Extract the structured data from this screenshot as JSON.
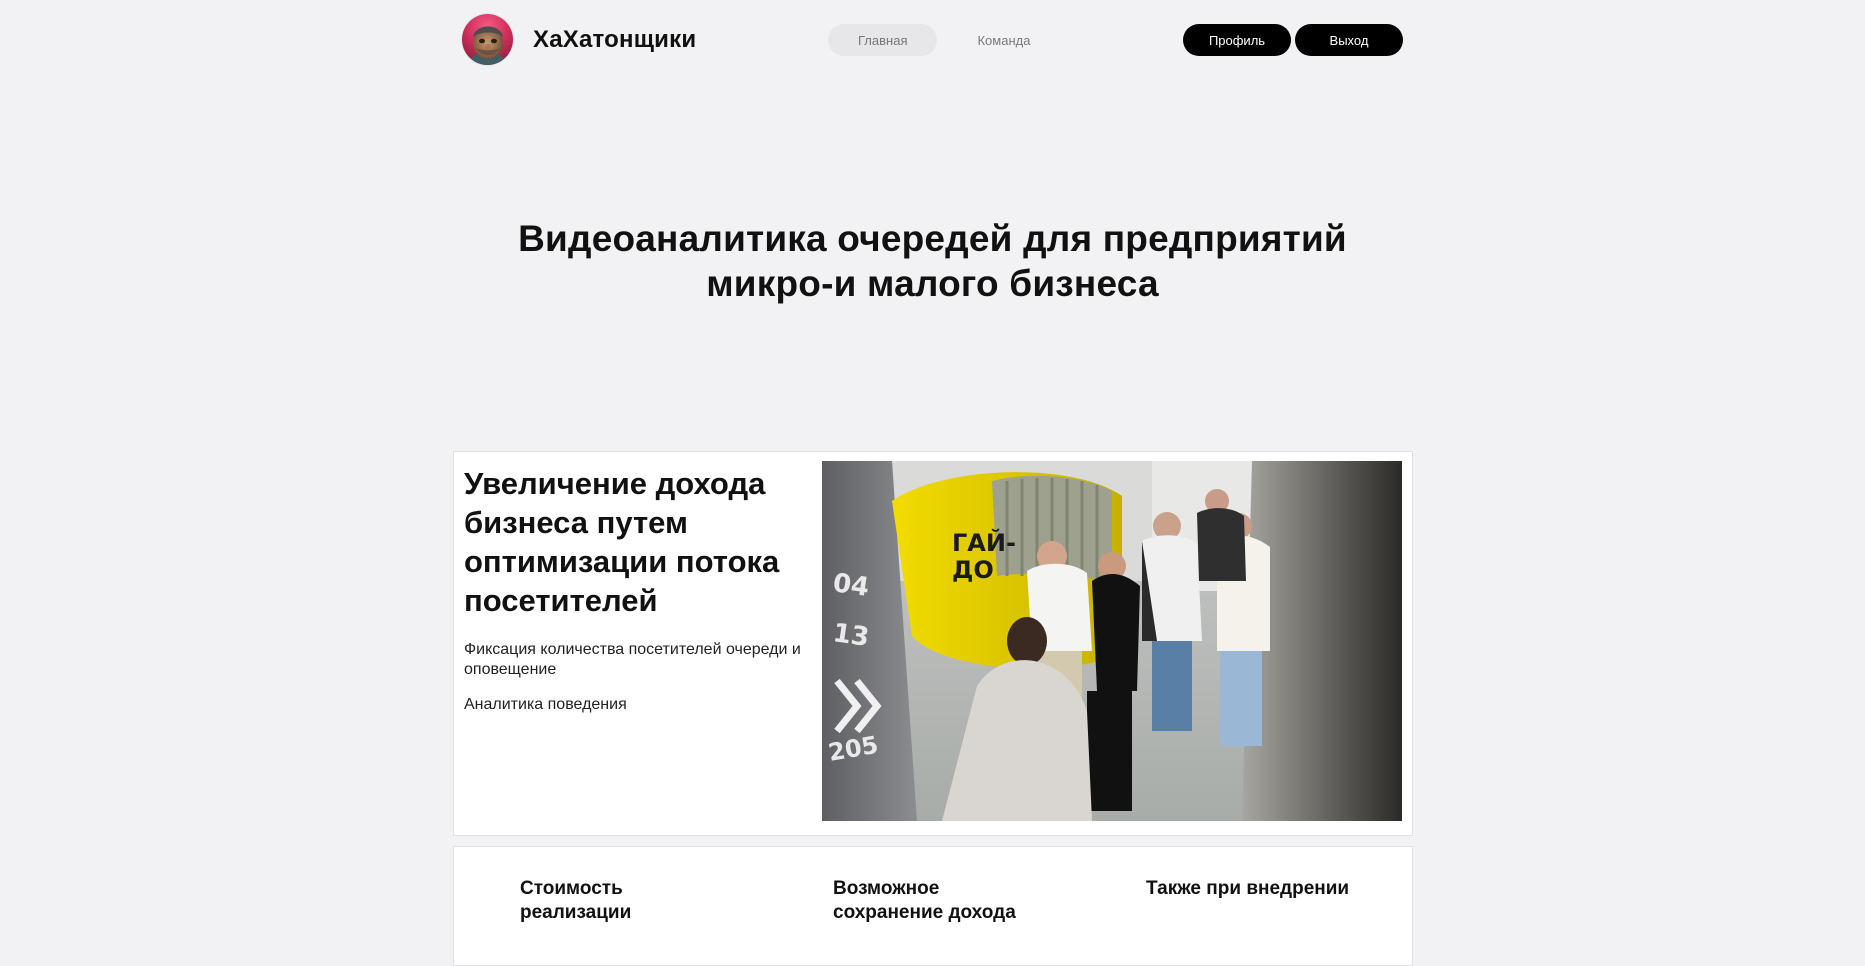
{
  "header": {
    "brand_name": "ХаХатонщики",
    "avatar_icon": "user-avatar-photo",
    "nav": [
      {
        "label": "Главная",
        "active": true
      },
      {
        "label": "Команда",
        "active": false
      }
    ],
    "profile_label": "Профиль",
    "logout_label": "Выход"
  },
  "hero": {
    "title": "Видеоаналитика очередей для предприятий микро-и малого бизнеса"
  },
  "feature": {
    "title": "Увеличение дохода бизнеса путем оптимизации потока посетителей",
    "points": [
      "Фиксация количества посетителей очереди и оповещение",
      "Аналитика поведения"
    ],
    "image_sign_text": "ГАЙ-\nДО",
    "image_wall_numbers": [
      "04",
      "13",
      "205"
    ]
  },
  "stats": {
    "items": [
      {
        "label": "Стоимость реализации"
      },
      {
        "label": "Возможное сохранение дохода"
      },
      {
        "label": "Также при внедрении"
      }
    ]
  },
  "colors": {
    "page_bg": "#f2f2f4",
    "card_bg": "#ffffff",
    "button_bg": "#000000",
    "button_text": "#ffffff",
    "accent_yellow": "#e9d200"
  }
}
